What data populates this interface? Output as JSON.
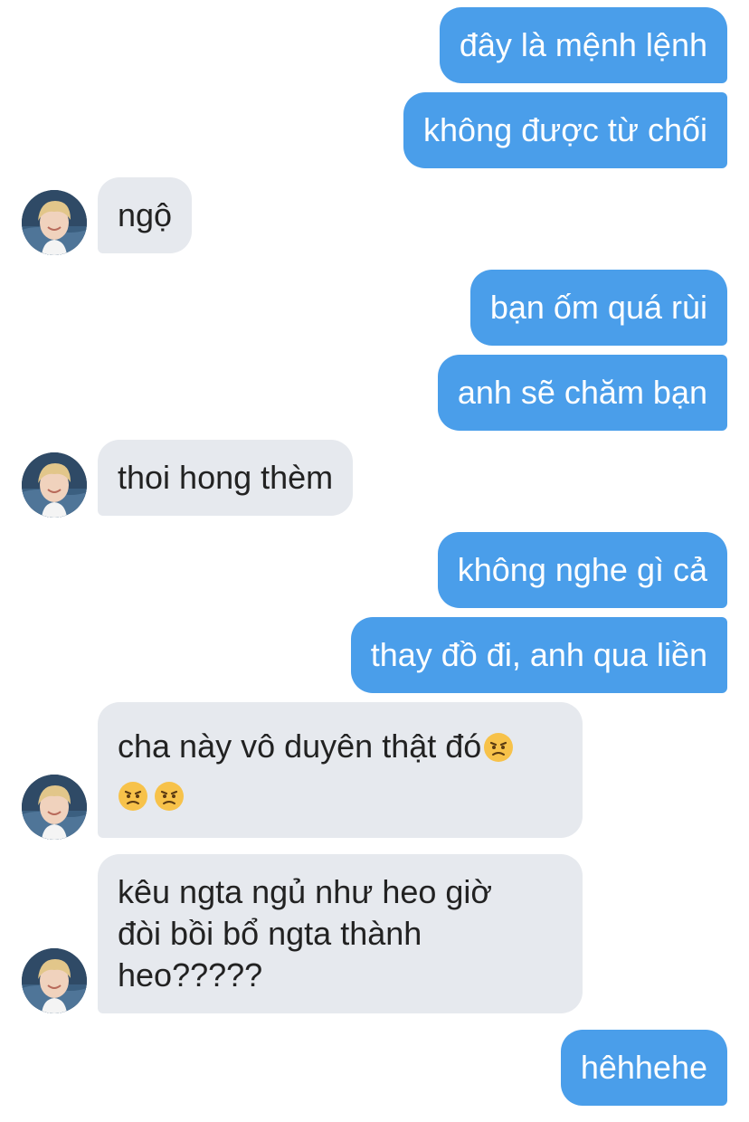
{
  "messages": [
    {
      "side": "sent",
      "text": "đây là mệnh lệnh"
    },
    {
      "side": "sent",
      "text": "không được từ chối"
    },
    {
      "side": "received",
      "text": "ngộ"
    },
    {
      "side": "sent",
      "text": "bạn ốm quá rùi"
    },
    {
      "side": "sent",
      "text": "anh sẽ chăm bạn"
    },
    {
      "side": "received",
      "text": "thoi hong thèm"
    },
    {
      "side": "sent",
      "text": "không nghe gì cả"
    },
    {
      "side": "sent",
      "text": "thay đồ đi, anh qua liền"
    },
    {
      "side": "received",
      "text": "cha này vô duyên thật đó",
      "emoji": [
        "angry-face",
        "angry-face",
        "angry-face"
      ]
    },
    {
      "side": "received",
      "lines": [
        "kêu ngta ngủ như heo giờ",
        "đòi bồi bổ ngta thành",
        "heo?????"
      ]
    },
    {
      "side": "sent",
      "text": "hêhhehe"
    }
  ],
  "colors": {
    "sent_bubble": "#4a9eea",
    "received_bubble": "#e6e9ee",
    "sent_text": "#ffffff",
    "received_text": "#222222",
    "background": "#ffffff"
  },
  "icons": {
    "avatar": "user-avatar",
    "emoji": "angry-face-emoji"
  }
}
